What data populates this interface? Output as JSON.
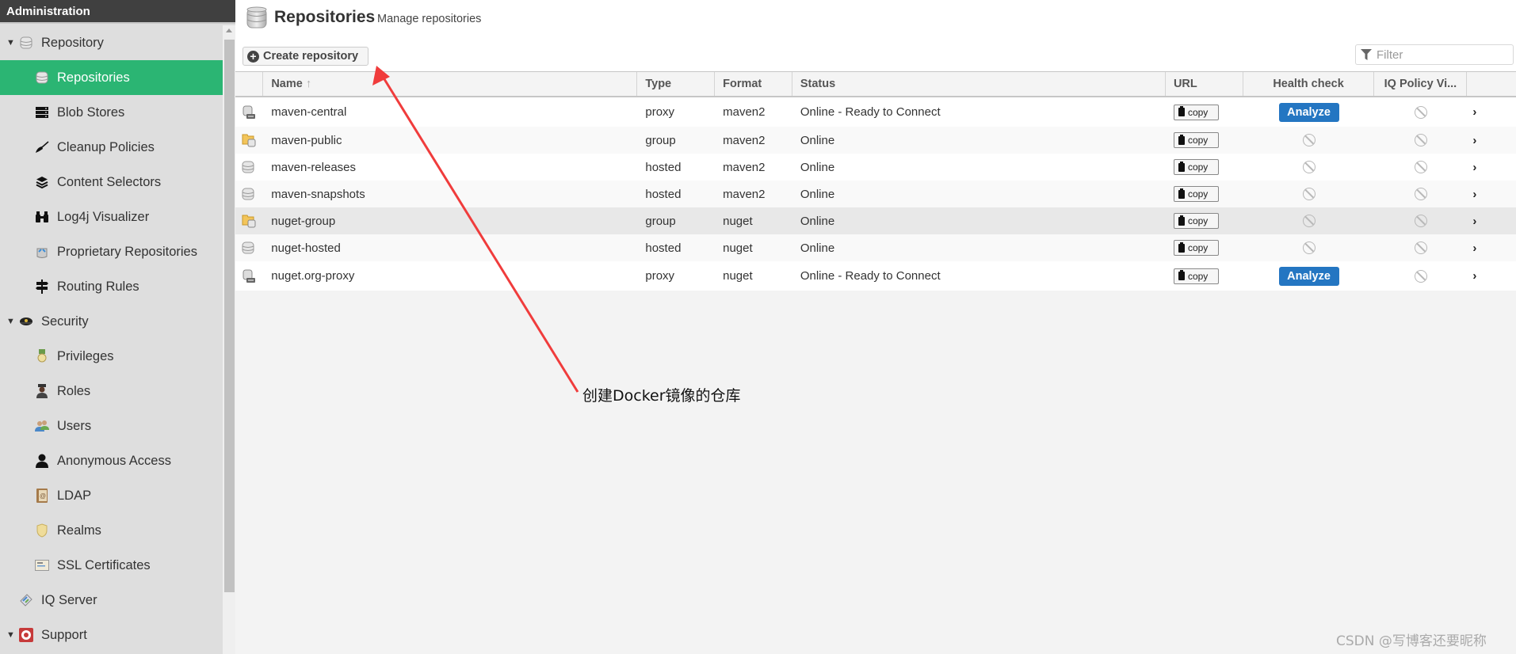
{
  "sidebar": {
    "header": "Administration",
    "items": [
      {
        "label": "Repository",
        "kind": "group",
        "icon": "database-icon"
      },
      {
        "label": "Repositories",
        "kind": "child",
        "icon": "database-icon",
        "active": true
      },
      {
        "label": "Blob Stores",
        "kind": "child",
        "icon": "server-icon"
      },
      {
        "label": "Cleanup Policies",
        "kind": "child",
        "icon": "broom-icon"
      },
      {
        "label": "Content Selectors",
        "kind": "child",
        "icon": "layers-icon"
      },
      {
        "label": "Log4j Visualizer",
        "kind": "child",
        "icon": "binoculars-icon"
      },
      {
        "label": "Proprietary Repositories",
        "kind": "child",
        "icon": "proprietary-icon"
      },
      {
        "label": "Routing Rules",
        "kind": "child",
        "icon": "signpost-icon"
      },
      {
        "label": "Security",
        "kind": "group",
        "icon": "police-hat-icon"
      },
      {
        "label": "Privileges",
        "kind": "child",
        "icon": "medal-icon"
      },
      {
        "label": "Roles",
        "kind": "child",
        "icon": "officer-icon"
      },
      {
        "label": "Users",
        "kind": "child",
        "icon": "users-icon"
      },
      {
        "label": "Anonymous Access",
        "kind": "child",
        "icon": "user-icon"
      },
      {
        "label": "LDAP",
        "kind": "child",
        "icon": "address-book-icon"
      },
      {
        "label": "Realms",
        "kind": "child",
        "icon": "shield-icon"
      },
      {
        "label": "SSL Certificates",
        "kind": "child",
        "icon": "certificate-icon"
      },
      {
        "label": "IQ Server",
        "kind": "plain",
        "icon": "iq-server-icon"
      },
      {
        "label": "Support",
        "kind": "group",
        "icon": "lifebuoy-icon"
      }
    ]
  },
  "header": {
    "title": "Repositories",
    "subtitle": "Manage repositories",
    "create_label": "Create repository",
    "filter_placeholder": "Filter"
  },
  "table": {
    "columns": {
      "name": "Name",
      "type": "Type",
      "format": "Format",
      "status": "Status",
      "url": "URL",
      "health": "Health check",
      "iq": "IQ Policy Vi..."
    },
    "copy_label": "copy",
    "analyze_label": "Analyze",
    "rows": [
      {
        "name": "maven-central",
        "type": "proxy",
        "format": "maven2",
        "status": "Online - Ready to Connect",
        "icon": "proxy-repo-icon",
        "health": "analyze"
      },
      {
        "name": "maven-public",
        "type": "group",
        "format": "maven2",
        "status": "Online",
        "icon": "group-repo-icon",
        "health": "disabled"
      },
      {
        "name": "maven-releases",
        "type": "hosted",
        "format": "maven2",
        "status": "Online",
        "icon": "hosted-repo-icon",
        "health": "disabled"
      },
      {
        "name": "maven-snapshots",
        "type": "hosted",
        "format": "maven2",
        "status": "Online",
        "icon": "hosted-repo-icon",
        "health": "disabled"
      },
      {
        "name": "nuget-group",
        "type": "group",
        "format": "nuget",
        "status": "Online",
        "icon": "group-repo-icon",
        "health": "disabled",
        "selected": true
      },
      {
        "name": "nuget-hosted",
        "type": "hosted",
        "format": "nuget",
        "status": "Online",
        "icon": "hosted-repo-icon",
        "health": "disabled"
      },
      {
        "name": "nuget.org-proxy",
        "type": "proxy",
        "format": "nuget",
        "status": "Online - Ready to Connect",
        "icon": "proxy-repo-icon",
        "health": "analyze"
      }
    ]
  },
  "annotation": {
    "text": "创建Docker镜像的仓库",
    "color": "#f03c3c"
  },
  "watermark": "CSDN @写博客还要昵称",
  "colors": {
    "active": "#2bb573",
    "analyze": "#2476c2",
    "header_bg": "#404040"
  }
}
